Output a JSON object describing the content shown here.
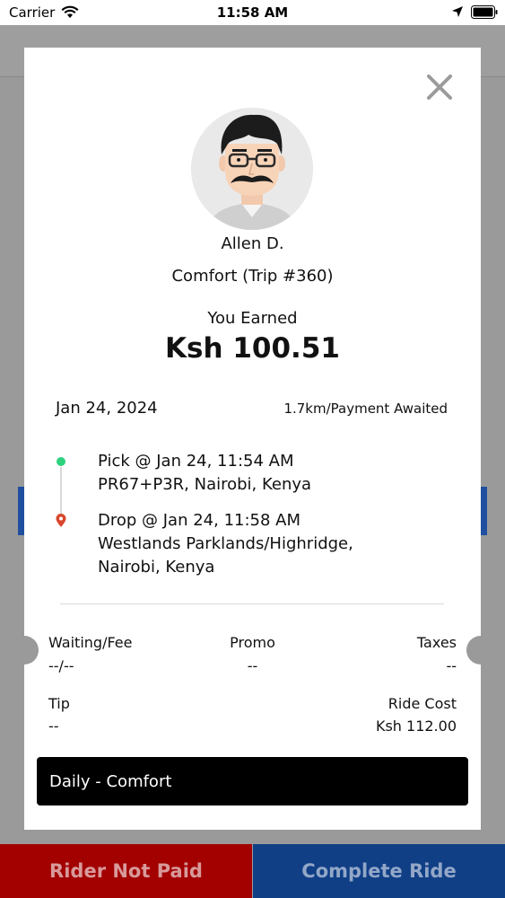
{
  "status_bar": {
    "carrier": "Carrier",
    "time": "11:58 AM"
  },
  "modal": {
    "rider_name": "Allen D.",
    "trip_type": "Comfort (Trip #360)",
    "earned_label": "You Earned",
    "earned_amount": "Ksh 100.51",
    "date": "Jan 24, 2024",
    "meta": "1.7km/Payment Awaited",
    "pick": {
      "title": "Pick @ Jan 24, 11:54 AM",
      "address": "PR67+P3R, Nairobi, Kenya"
    },
    "drop": {
      "title": "Drop @ Jan 24, 11:58 AM",
      "address_line1": "Westlands Parklands/Highridge,",
      "address_line2": "Nairobi, Kenya"
    },
    "fees": {
      "waiting_label": "Waiting/Fee",
      "waiting_value": "--/--",
      "promo_label": "Promo",
      "promo_value": "--",
      "taxes_label": "Taxes",
      "taxes_value": "--",
      "tip_label": "Tip",
      "tip_value": "--",
      "ride_cost_label": "Ride Cost",
      "ride_cost_value": "Ksh 112.00"
    },
    "plan": "Daily - Comfort"
  },
  "actions": {
    "not_paid": "Rider Not Paid",
    "complete": "Complete Ride"
  },
  "colors": {
    "pick_dot": "#2fd17f",
    "drop_pin": "#d9472b",
    "not_paid_bg": "#a30000",
    "complete_bg": "#103f86"
  }
}
